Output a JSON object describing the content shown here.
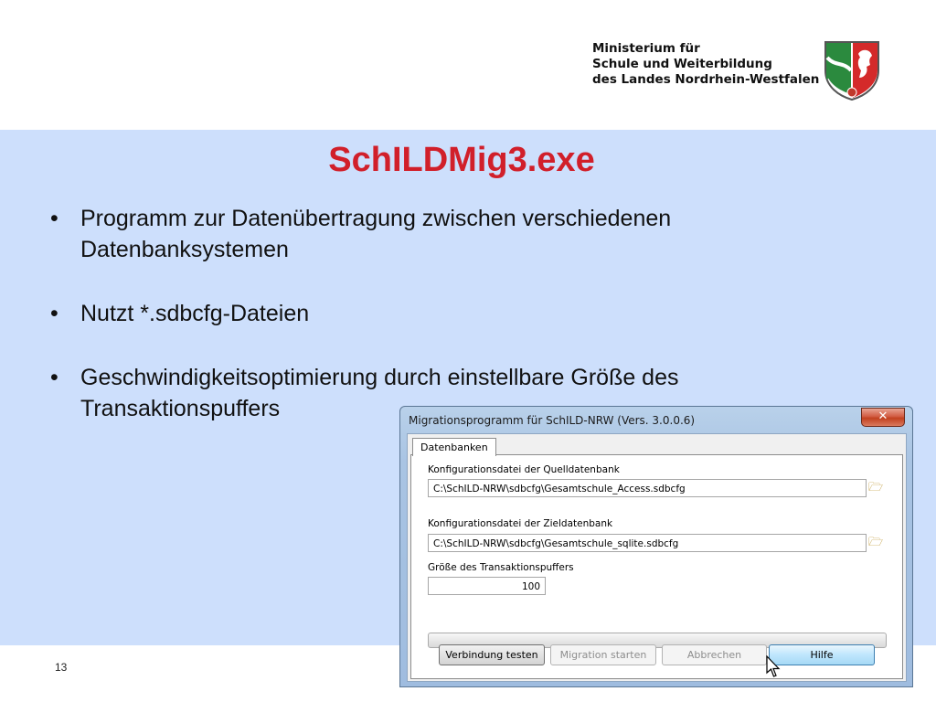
{
  "header": {
    "ministry_lines": [
      "Ministerium für",
      "Schule und Weiterbildung",
      "des Landes Nordrhein-Westfalen"
    ],
    "crest_icon": "nrw-coat-of-arms"
  },
  "slide": {
    "title": "SchILDMig3.exe",
    "bullets": [
      "Programm zur Datenübertragung zwischen verschiedenen Datenbanksystemen",
      "Nutzt *.sdbcfg-Dateien",
      "Geschwindigkeitsoptimierung durch einstellbare Größe des Transaktionspuffers"
    ],
    "bullet_symbol": "•",
    "page_number": "13"
  },
  "window": {
    "title": "Migrationsprogramm für SchILD-NRW (Vers. 3.0.0.6)",
    "close_symbol": "✕",
    "tab_label": "Datenbanken",
    "source_label": "Konfigurationsdatei der Quelldatenbank",
    "source_value": "C:\\SchILD-NRW\\sdbcfg\\Gesamtschule_Access.sdbcfg",
    "target_label": "Konfigurationsdatei der Zieldatenbank",
    "target_value": "C:\\SchILD-NRW\\sdbcfg\\Gesamtschule_sqlite.sdbcfg",
    "buffer_label": "Größe des Transaktionspuffers",
    "buffer_value": "100",
    "progress_value": 0,
    "buttons": {
      "test": "Verbindung testen",
      "start": "Migration starten",
      "cancel": "Abbrechen",
      "help": "Hilfe"
    }
  },
  "colors": {
    "title_red": "#d11f2a",
    "slide_background": "#cddffc",
    "window_frame": "#b9d1ea"
  }
}
